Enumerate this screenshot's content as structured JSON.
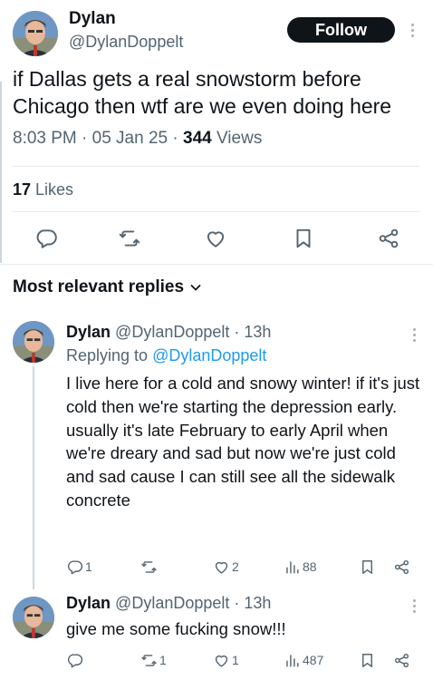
{
  "tweet": {
    "author_name": "Dylan",
    "author_handle": "@DylanDoppelt",
    "follow_label": "Follow",
    "text": "if Dallas gets a real snowstorm before Chicago then wtf are we even doing here",
    "time": "8:03 PM · 05 Jan 25 · ",
    "views_count": "344",
    "views_label": " Views",
    "likes_count": "17",
    "likes_label": " Likes"
  },
  "replies_heading": "Most relevant replies",
  "replies": [
    {
      "name": "Dylan",
      "handle_time": "@DylanDoppelt · 13h",
      "replying_prefix": "Replying to ",
      "replying_mention": "@DylanDoppelt",
      "text": "I live here for a cold and snowy winter! if it's just cold then we're starting the depression early. usually it's late February to early April when we're dreary and sad but now we're just cold and sad cause I can still see all the sidewalk concrete",
      "reply_count": "1",
      "retweet_count": "",
      "like_count": "2",
      "view_count": "88"
    },
    {
      "name": "Dylan",
      "handle_time": "@DylanDoppelt · 13h",
      "text": "give me some fucking snow!!!",
      "reply_count": "",
      "retweet_count": "1",
      "like_count": "1",
      "view_count": "487"
    }
  ],
  "icons": {
    "reply": "reply-icon",
    "retweet": "retweet-icon",
    "like": "heart-icon",
    "bookmark": "bookmark-icon",
    "share": "share-icon",
    "views": "views-icon",
    "more": "more-icon",
    "chevron": "chevron-down-icon"
  },
  "colors": {
    "link": "#1d9bf0",
    "secondary_text": "#536471",
    "primary_text": "#0f1419",
    "follow_bg": "#0f1419"
  }
}
